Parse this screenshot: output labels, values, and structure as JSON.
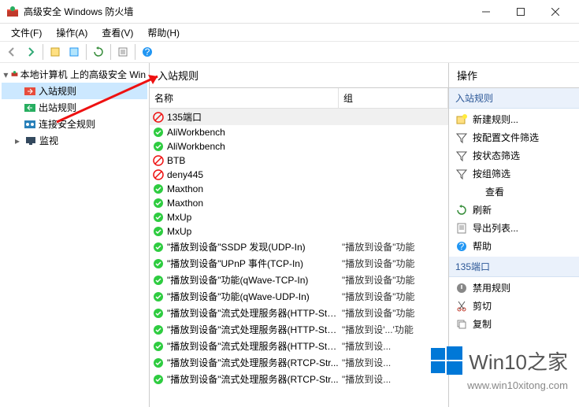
{
  "window": {
    "title": "高级安全 Windows 防火墙"
  },
  "menu": {
    "file": "文件(F)",
    "action": "操作(A)",
    "view": "查看(V)",
    "help": "帮助(H)"
  },
  "tree": {
    "root": "本地计算机 上的高级安全 Win",
    "inbound": "入站规则",
    "outbound": "出站规则",
    "connsec": "连接安全规则",
    "monitor": "监视"
  },
  "center": {
    "title": "入站规则",
    "col_name": "名称",
    "col_group": "组"
  },
  "rules": [
    {
      "icon": "block",
      "name": "135端口",
      "group": "",
      "selected": true
    },
    {
      "icon": "allow",
      "name": "AliWorkbench",
      "group": ""
    },
    {
      "icon": "allow",
      "name": "AliWorkbench",
      "group": ""
    },
    {
      "icon": "block",
      "name": "BTB",
      "group": ""
    },
    {
      "icon": "block",
      "name": "deny445",
      "group": ""
    },
    {
      "icon": "allow",
      "name": "Maxthon",
      "group": ""
    },
    {
      "icon": "allow",
      "name": "Maxthon",
      "group": ""
    },
    {
      "icon": "allow",
      "name": "MxUp",
      "group": ""
    },
    {
      "icon": "allow",
      "name": "MxUp",
      "group": ""
    },
    {
      "icon": "allow",
      "name": "\"播放到设备\"SSDP 发现(UDP-In)",
      "group": "\"播放到设备\"功能"
    },
    {
      "icon": "allow",
      "name": "\"播放到设备\"UPnP 事件(TCP-In)",
      "group": "\"播放到设备\"功能"
    },
    {
      "icon": "allow",
      "name": "\"播放到设备\"功能(qWave-TCP-In)",
      "group": "\"播放到设备\"功能"
    },
    {
      "icon": "allow",
      "name": "\"播放到设备\"功能(qWave-UDP-In)",
      "group": "\"播放到设备\"功能"
    },
    {
      "icon": "allow",
      "name": "\"播放到设备\"流式处理服务器(HTTP-Stre...",
      "group": "\"播放到设备\"功能"
    },
    {
      "icon": "allow",
      "name": "\"播放到设备\"流式处理服务器(HTTP-Stre...",
      "group": "\"播放到设'...'功能"
    },
    {
      "icon": "allow",
      "name": "\"播放到设备\"流式处理服务器(HTTP-Stre...",
      "group": "\"播放到设..."
    },
    {
      "icon": "allow",
      "name": "\"播放到设备\"流式处理服务器(RTCP-Str...",
      "group": "\"播放到设..."
    },
    {
      "icon": "allow",
      "name": "\"播放到设备\"流式处理服务器(RTCP-Str...",
      "group": "\"播放到设..."
    }
  ],
  "actions": {
    "title": "操作",
    "section1": "入站规则",
    "items1": [
      {
        "icon": "new",
        "label": "新建规则..."
      },
      {
        "icon": "filter",
        "label": "按配置文件筛选"
      },
      {
        "icon": "filter",
        "label": "按状态筛选"
      },
      {
        "icon": "filter",
        "label": "按组筛选"
      },
      {
        "icon": "",
        "label": "查看",
        "indent": true
      },
      {
        "icon": "refresh",
        "label": "刷新"
      },
      {
        "icon": "export",
        "label": "导出列表..."
      },
      {
        "icon": "help",
        "label": "帮助"
      }
    ],
    "section2": "135端口",
    "items2": [
      {
        "icon": "disable",
        "label": "禁用规则"
      },
      {
        "icon": "cut",
        "label": "剪切"
      },
      {
        "icon": "copy",
        "label": "复制"
      }
    ]
  },
  "watermark": {
    "text": "Win10之家",
    "url": "www.win10xitong.com"
  }
}
